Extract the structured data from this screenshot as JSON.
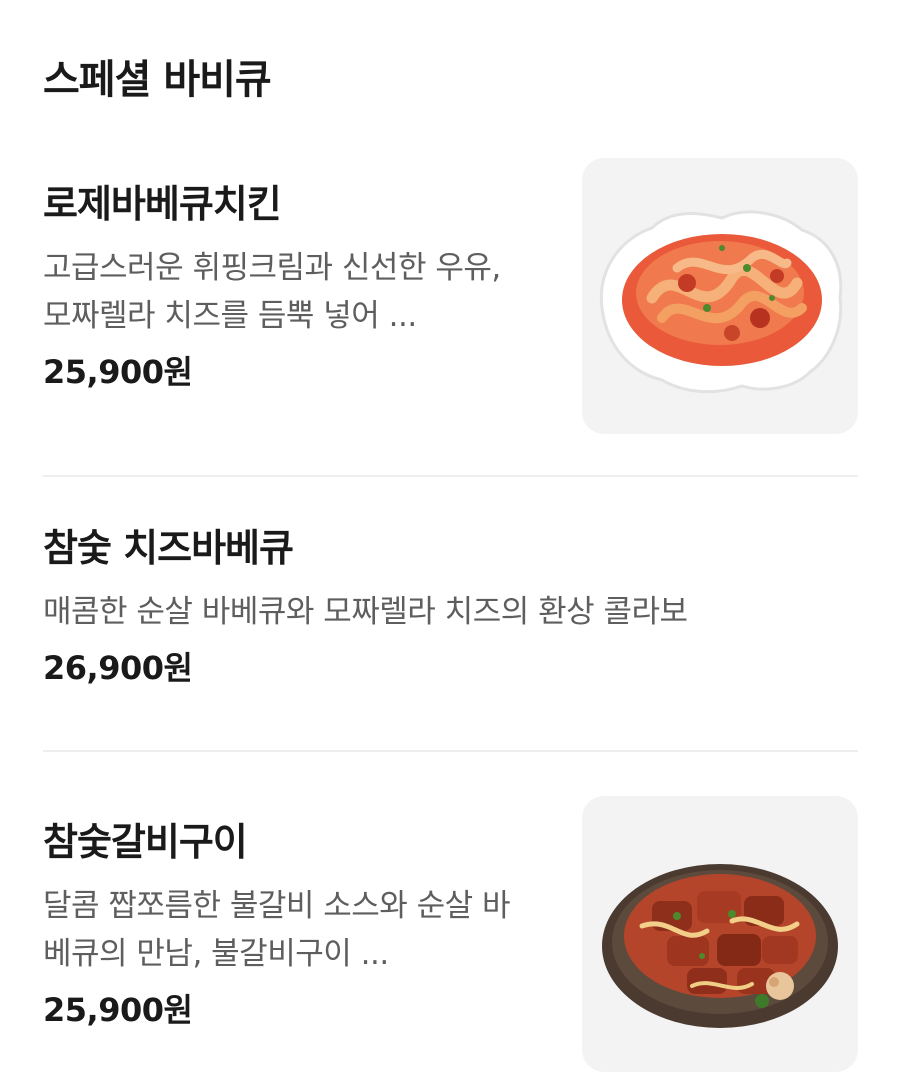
{
  "section": {
    "title": "스페셜 바비큐"
  },
  "items": [
    {
      "name": "로제바베큐치킨",
      "description": "고급스러운 휘핑크림과 신선한 우유, 모짜렐라 치즈를 듬뿍 넣어 ...",
      "price": "25,900원",
      "image": "rose-bbq-chicken-photo"
    },
    {
      "name": "참숯 치즈바베큐",
      "description": "매콤한 순살 바베큐와 모짜렐라 치즈의 환상 콜라보",
      "price": "26,900원"
    },
    {
      "name": "참숯갈비구이",
      "description": "달콤 짭쪼름한 불갈비 소스와 순살 바베큐의 만남, 불갈비구이 ...",
      "price": "25,900원",
      "image": "charcoal-galbi-photo"
    }
  ]
}
